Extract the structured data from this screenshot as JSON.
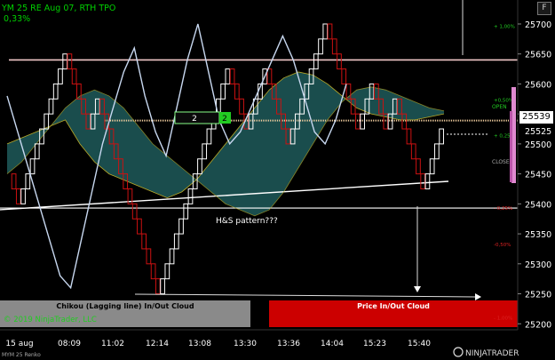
{
  "header": {
    "title": "YM 25 RE Aug 07, RTH TPO",
    "change": "0,33%",
    "window_button": "F"
  },
  "footer": {
    "instrument": "MYM 25 Renko",
    "copyright": "© 2019 NinjaTrader, LLC",
    "logo": "NINJATRADER"
  },
  "panels": {
    "chikou_label": "Chikou (Lagging line) In/Out Cloud",
    "price_label": "Price In/Out Cloud"
  },
  "annotations": {
    "pattern": "H&S pattern???",
    "box_left": "2",
    "box_right": "2",
    "open_label": "OPEN",
    "close_label": "CLOSE",
    "current_price": "25539",
    "price_under_tag": "25525"
  },
  "colors": {
    "background": "#000000",
    "axis_text": "#ffffff",
    "pct_positive": "#22cc22",
    "pct_negative": "#dd2222",
    "brick_up": "#ffffff",
    "brick_down": "#cc1111",
    "cloud": "#1e5a5a",
    "chikou_line": "#c8d8f0",
    "senkou_line": "#b8a828",
    "chikou_panel": "#8a8a8a",
    "price_panel": "#cc0000",
    "marker_pink": "#e08ad0",
    "level_line": "#f0c8c8"
  },
  "chart_data": {
    "type": "renko",
    "brick_size": 25,
    "y_axis": {
      "ylim": [
        25190,
        25740
      ],
      "ticks": [
        25200,
        25250,
        25300,
        25350,
        25400,
        25450,
        25500,
        25550,
        25600,
        25650,
        25700
      ],
      "percent_ticks": [
        {
          "label": "+ 1,00%",
          "value": 25696
        },
        {
          "label": "+0,50%",
          "value": 25573
        },
        {
          "label": "+ 0,25%",
          "value": 25514
        },
        {
          "label": "- 0,25%",
          "value": 25393
        },
        {
          "label": "-0,50%",
          "value": 25332
        },
        {
          "label": "- 1,00%",
          "value": 25210
        }
      ]
    },
    "x_axis": {
      "labels": [
        "15 aug",
        "08:09",
        "11:02",
        "12:14",
        "13:08",
        "13:30",
        "13:36",
        "14:04",
        "15:23",
        "15:40"
      ]
    },
    "renko_closes": [
      25450,
      25425,
      25400,
      25425,
      25450,
      25475,
      25500,
      25525,
      25550,
      25575,
      25600,
      25625,
      25650,
      25625,
      25600,
      25575,
      25550,
      25525,
      25550,
      25575,
      25550,
      25525,
      25500,
      25475,
      25450,
      25425,
      25400,
      25375,
      25350,
      25325,
      25300,
      25275,
      25250,
      25275,
      25300,
      25325,
      25350,
      25375,
      25400,
      25425,
      25450,
      25475,
      25500,
      25525,
      25550,
      25575,
      25600,
      25625,
      25600,
      25575,
      25550,
      25525,
      25550,
      25575,
      25600,
      25625,
      25600,
      25575,
      25550,
      25525,
      25500,
      25525,
      25550,
      25575,
      25600,
      25625,
      25650,
      25675,
      25700,
      25675,
      25650,
      25625,
      25600,
      25575,
      25550,
      25525,
      25550,
      25575,
      25600,
      25575,
      25550,
      25525,
      25550,
      25575,
      25550,
      25525,
      25500,
      25475,
      25450,
      25425,
      25450,
      25475,
      25500,
      25525
    ],
    "chikou": [
      25580,
      25520,
      25460,
      25400,
      25340,
      25280,
      25260,
      25340,
      25420,
      25500,
      25560,
      25620,
      25660,
      25580,
      25520,
      25480,
      25560,
      25640,
      25700,
      25620,
      25540,
      25500,
      25520,
      25560,
      25600,
      25640,
      25680,
      25640,
      25580,
      25520,
      25500,
      25540,
      25600
    ],
    "senkou_a": [
      25500,
      25510,
      25520,
      25530,
      25540,
      25500,
      25470,
      25450,
      25440,
      25430,
      25420,
      25410,
      25420,
      25440,
      25470,
      25500,
      25530,
      25560,
      25590,
      25610,
      25620,
      25615,
      25600,
      25580,
      25560,
      25550,
      25545,
      25540,
      25540,
      25545,
      25550
    ],
    "senkou_b": [
      25450,
      25470,
      25500,
      25530,
      25560,
      25580,
      25590,
      25580,
      25560,
      25530,
      25500,
      25480,
      25460,
      25440,
      25420,
      25400,
      25390,
      25380,
      25390,
      25420,
      25460,
      25500,
      25540,
      25570,
      25590,
      25595,
      25590,
      25580,
      25570,
      25560,
      25555
    ],
    "horizontal_lines": [
      {
        "name": "upper-level",
        "value": 25640
      },
      {
        "name": "current-price",
        "value": 25539
      },
      {
        "name": "lower-level",
        "value": 25393
      }
    ],
    "trend_line": {
      "from": {
        "x_label": "15 aug",
        "value": 25405
      },
      "to": {
        "x_label": "15:40",
        "value": 25445
      }
    }
  }
}
